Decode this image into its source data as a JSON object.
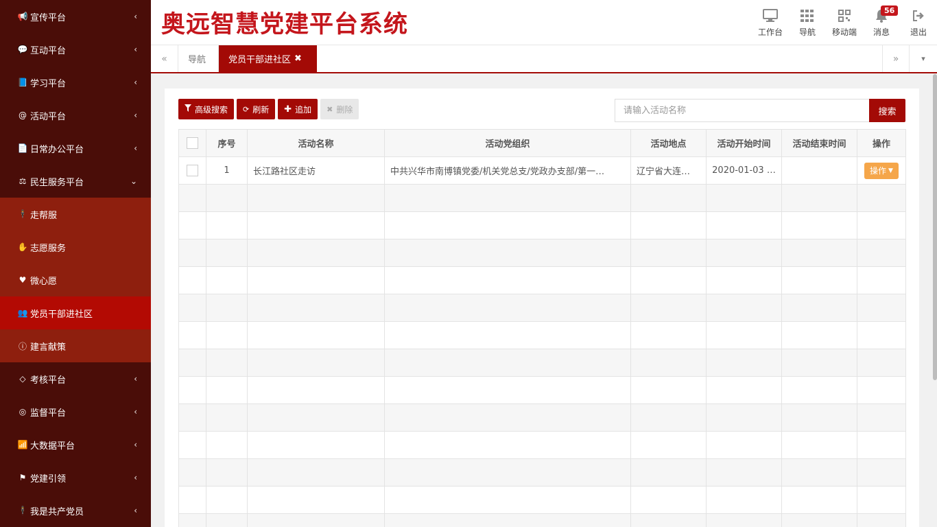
{
  "app": {
    "title": "奥远智慧党建平台系统"
  },
  "sidebar": {
    "items": [
      {
        "label": "宣传平台",
        "icon": "bullhorn-icon",
        "glyph": "📢",
        "chevron": "‹"
      },
      {
        "label": "互动平台",
        "icon": "comments-icon",
        "glyph": "💬",
        "chevron": "‹"
      },
      {
        "label": "学习平台",
        "icon": "book-icon",
        "glyph": "📘",
        "chevron": "‹"
      },
      {
        "label": "活动平台",
        "icon": "at-icon",
        "glyph": "@",
        "chevron": "‹"
      },
      {
        "label": "日常办公平台",
        "icon": "files-icon",
        "glyph": "📄",
        "chevron": "‹"
      },
      {
        "label": "民生服务平台",
        "icon": "balance-scale-icon",
        "glyph": "⚖",
        "chevron": "⌄"
      }
    ],
    "subitems": [
      {
        "label": "走帮服",
        "icon": "person-icon",
        "glyph": "🕴"
      },
      {
        "label": "志愿服务",
        "icon": "hand-icon",
        "glyph": "✋"
      },
      {
        "label": "微心愿",
        "icon": "heart-icon",
        "glyph": "♥"
      },
      {
        "label": "党员干部进社区",
        "icon": "users-icon",
        "glyph": "👥"
      },
      {
        "label": "建言献策",
        "icon": "suggestion-icon",
        "glyph": "ⓘ"
      }
    ],
    "items2": [
      {
        "label": "考核平台",
        "icon": "diamond-icon",
        "glyph": "◇",
        "chevron": "‹"
      },
      {
        "label": "监督平台",
        "icon": "eye-icon",
        "glyph": "◎",
        "chevron": "‹"
      },
      {
        "label": "大数据平台",
        "icon": "signal-icon",
        "glyph": "📶",
        "chevron": "‹"
      },
      {
        "label": "党建引领",
        "icon": "flag-icon",
        "glyph": "⚑",
        "chevron": "‹"
      },
      {
        "label": "我是共产党员",
        "icon": "member-icon",
        "glyph": "🕴",
        "chevron": "‹"
      }
    ]
  },
  "header": {
    "tools": [
      {
        "label": "工作台",
        "icon": "monitor-icon"
      },
      {
        "label": "导航",
        "icon": "grid-icon"
      },
      {
        "label": "移动端",
        "icon": "qrcode-icon"
      },
      {
        "label": "消息",
        "icon": "bell-icon",
        "badge": "56"
      },
      {
        "label": "退出",
        "icon": "logout-icon"
      }
    ]
  },
  "tabs": {
    "prev": "«",
    "next": "»",
    "menu": "▾",
    "items": [
      {
        "label": "导航"
      },
      {
        "label": "党员干部进社区",
        "close": "✖"
      }
    ]
  },
  "toolbar": {
    "advanced_search": "高级搜索",
    "refresh": "刷新",
    "add": "追加",
    "delete": "删除"
  },
  "search": {
    "placeholder": "请输入活动名称",
    "button": "搜索"
  },
  "table": {
    "headers": [
      "序号",
      "活动名称",
      "活动党组织",
      "活动地点",
      "活动开始时间",
      "活动结束时间",
      "操作"
    ],
    "rows": [
      {
        "index": "1",
        "name": "长江路社区走访",
        "org": "中共兴华市南博镇党委/机关党总支/党政办支部/第一…",
        "location": "辽宁省大连…",
        "start": "2020-01-03 …",
        "end": "",
        "action": "操作"
      }
    ],
    "empty_rows": 13
  },
  "colors": {
    "brand": "#a30a06",
    "title": "#c4161c",
    "sidebar": "#4a0d08",
    "submenu": "#8e1f0e",
    "active": "#b30a03",
    "action": "#f5a64a"
  }
}
